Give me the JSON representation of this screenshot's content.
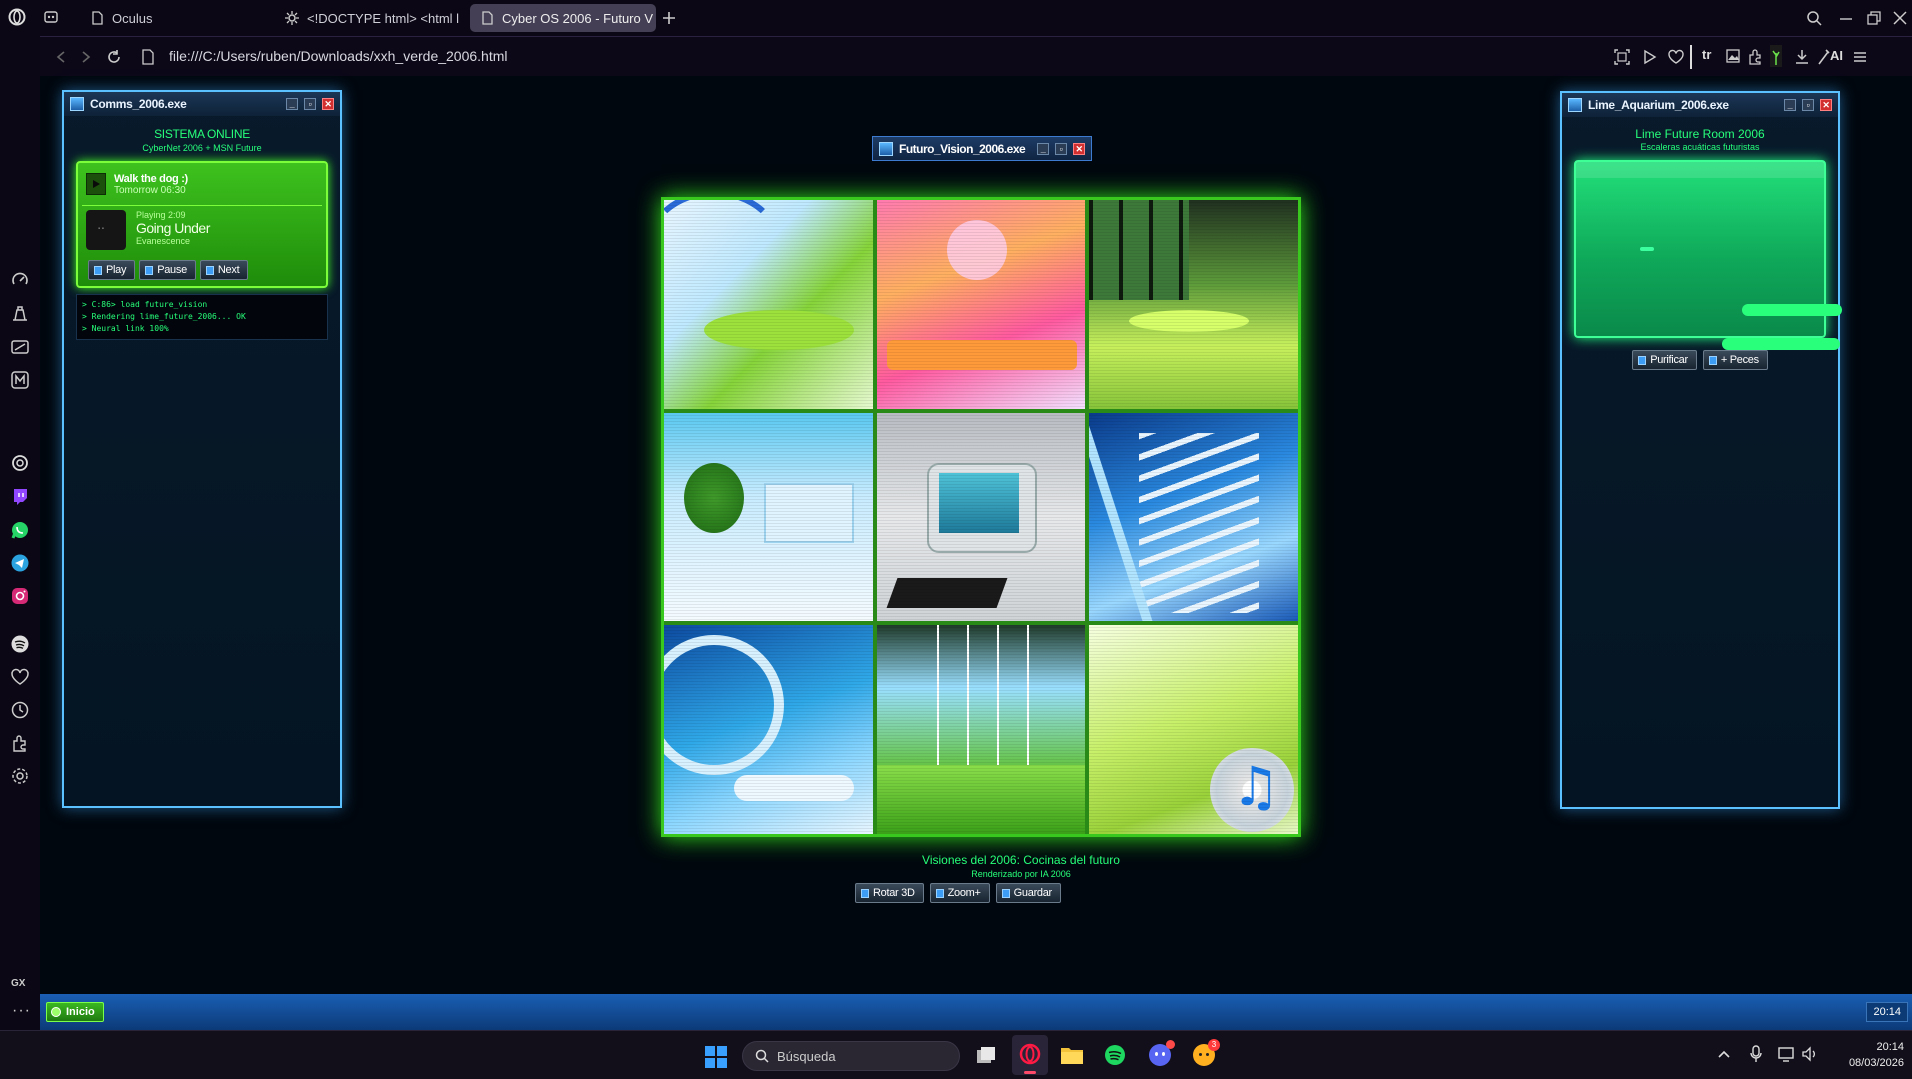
{
  "browser": {
    "tabs": [
      {
        "label": "Oculus",
        "icon": "document-icon"
      },
      {
        "label": "<!DOCTYPE html> <html l",
        "icon": "gear-icon"
      },
      {
        "label": "Cyber OS 2006 - Futuro V",
        "icon": "document-icon",
        "active": true
      }
    ],
    "url": "file:///C:/Users/ruben/Downloads/xxh_verde_2006.html",
    "toolbar_ai_label": "AI",
    "gx_label": "GX"
  },
  "comms": {
    "title": "Comms_2006.exe",
    "status": "SISTEMA ONLINE",
    "subtitle": "CyberNet 2006 + MSN Future",
    "reminder": {
      "title": "Walk the dog :)",
      "time": "Tomorrow 06:30"
    },
    "player": {
      "status": "Playing 2:09",
      "track": "Going Under",
      "artist": "Evanescence"
    },
    "buttons": [
      "Play",
      "Pause",
      "Next"
    ],
    "console": [
      "> C:86> load future_vision",
      "> Rendering lime_future_2006... OK",
      "> Neural link 100%"
    ]
  },
  "vision": {
    "title": "Futuro_Vision_2006.exe",
    "caption": "Visiones del 2006: Cocinas del futuro",
    "subcaption": "Renderizado por IA 2006",
    "buttons": [
      "Rotar 3D",
      "Zoom+",
      "Guardar"
    ],
    "tiles": [
      "kitchen-lime",
      "kitchen-pink",
      "kitchen-forest",
      "interior-white-blue",
      "retro-computer",
      "aquarium-stairs",
      "aquarium-lounge",
      "glass-corridor",
      "green-room-music"
    ]
  },
  "aquarium": {
    "title": "Lime_Aquarium_2006.exe",
    "heading": "Lime Future Room 2006",
    "subheading": "Escaleras acuáticas futuristas",
    "buttons": [
      "Purificar",
      "+ Peces"
    ]
  },
  "gx_taskbar": {
    "start": "Inicio",
    "clock": "20:14"
  },
  "windows_taskbar": {
    "search_placeholder": "Búsqueda",
    "time": "20:14",
    "date": "08/03/2026",
    "discord_badge": "3"
  },
  "colors": {
    "accent_green": "#27ff7a",
    "window_border": "#5bc2ff",
    "lime": "#39c81e"
  }
}
